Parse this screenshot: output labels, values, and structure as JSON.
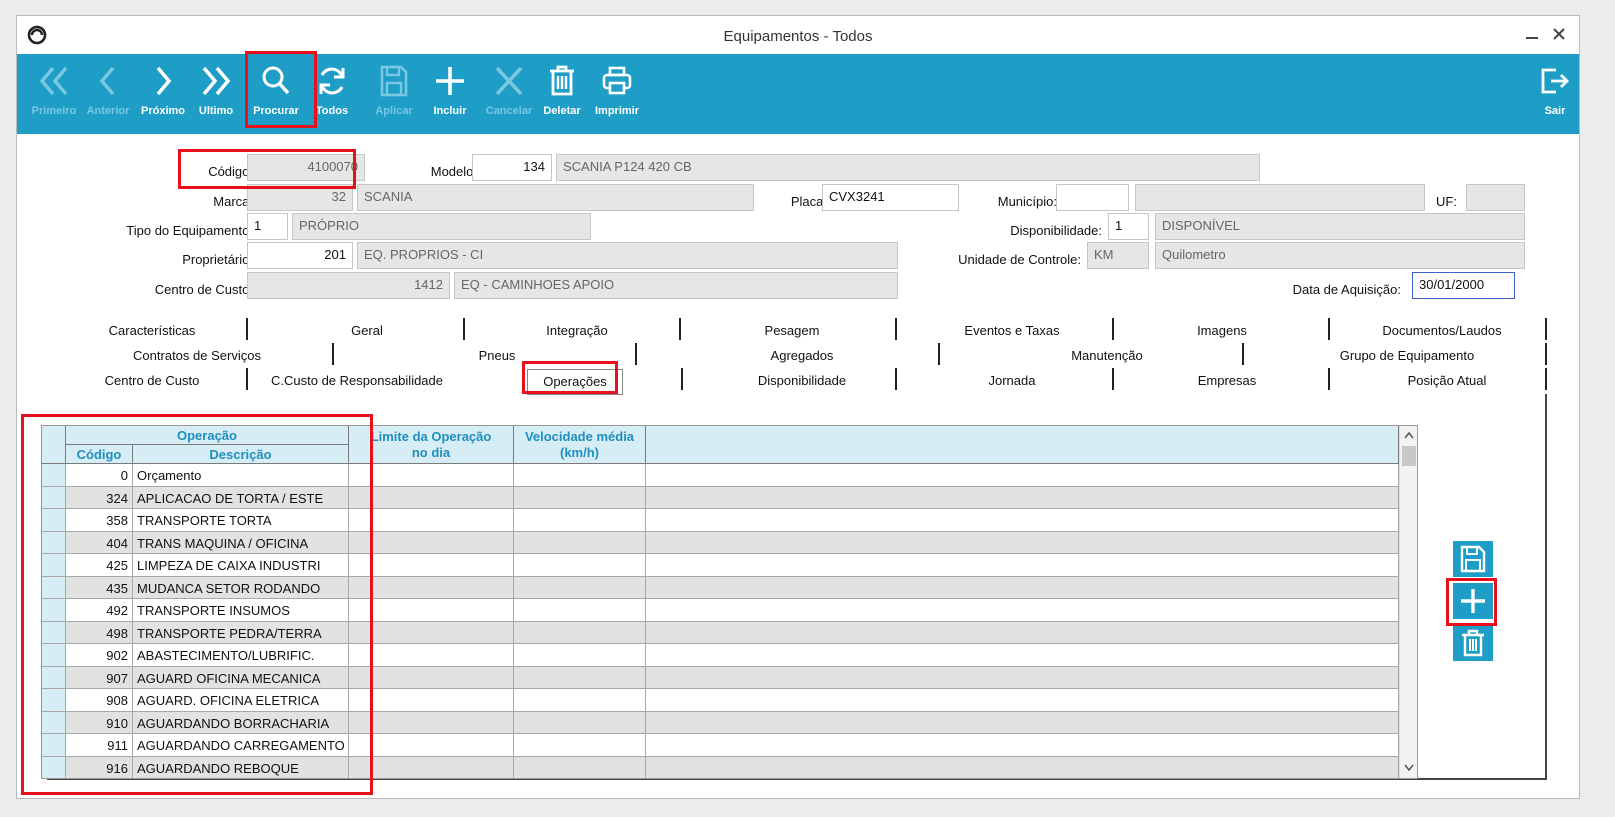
{
  "window": {
    "title": "Equipamentos - Todos"
  },
  "toolbar": {
    "buttons": [
      {
        "label": "Primeiro",
        "icon": "double-chevron-left-icon",
        "enabled": false
      },
      {
        "label": "Anterior",
        "icon": "chevron-left-icon",
        "enabled": false
      },
      {
        "label": "Próximo",
        "icon": "chevron-right-icon",
        "enabled": true
      },
      {
        "label": "Ultimo",
        "icon": "double-chevron-right-icon",
        "enabled": true
      },
      {
        "label": "Procurar",
        "icon": "search-icon",
        "enabled": true
      },
      {
        "label": "Todos",
        "icon": "refresh-icon",
        "enabled": true
      },
      {
        "label": "Aplicar",
        "icon": "save-icon",
        "enabled": false
      },
      {
        "label": "Incluir",
        "icon": "plus-icon",
        "enabled": true
      },
      {
        "label": "Cancelar",
        "icon": "close-icon",
        "enabled": false
      },
      {
        "label": "Deletar",
        "icon": "trash-icon",
        "enabled": true
      },
      {
        "label": "Imprimir",
        "icon": "printer-icon",
        "enabled": true
      }
    ],
    "exit": {
      "label": "Sair",
      "icon": "logout-icon"
    }
  },
  "form": {
    "codigo": {
      "label": "Código:",
      "value": "4100070"
    },
    "modelo": {
      "label": "Modelo:",
      "code": "134",
      "desc": "SCANIA P124 420 CB"
    },
    "marca": {
      "label": "Marca:",
      "code": "32",
      "desc": "SCANIA"
    },
    "placa": {
      "label": "Placa:",
      "value": "CVX3241"
    },
    "municipio": {
      "label": "Município:",
      "code": "",
      "desc": ""
    },
    "uf": {
      "label": "UF:",
      "value": ""
    },
    "tipo": {
      "label": "Tipo do Equipamento:",
      "code": "1",
      "desc": "PRÓPRIO"
    },
    "disponibilidade": {
      "label": "Disponibilidade:",
      "code": "1",
      "desc": "DISPONÍVEL"
    },
    "proprietario": {
      "label": "Proprietário:",
      "code": "201",
      "desc": "EQ. PROPRIOS - CI"
    },
    "unidade": {
      "label": "Unidade de Controle:",
      "code": "KM",
      "desc": "Quilometro"
    },
    "centro": {
      "label": "Centro de Custo:",
      "code": "1412",
      "desc": "EQ - CAMINHOES APOIO"
    },
    "aquisicao": {
      "label": "Data de Aquisição:",
      "value": "30/01/2000"
    }
  },
  "tabs": {
    "row1": [
      "Características",
      "Geral",
      "Integração",
      "Pesagem",
      "Eventos e Taxas",
      "Imagens",
      "Documentos/Laudos"
    ],
    "row2": [
      "Contratos de Serviços",
      "Pneus",
      "Agregados",
      "Manutenção",
      "Grupo de Equipamento"
    ],
    "row3": [
      "Centro de Custo",
      "C.Custo de Responsabilidade",
      "Operações",
      "Disponibilidade",
      "Jornada",
      "Empresas",
      "Posição Atual"
    ],
    "active": "Operações"
  },
  "grid": {
    "group_header": "Operação",
    "headers": {
      "codigo": "Código",
      "descricao": "Descrição",
      "limite": "Limite da Operação no dia",
      "velocidade": "Velocidade média (km/h)"
    },
    "rows": [
      {
        "codigo": "0",
        "descricao": "Orçamento"
      },
      {
        "codigo": "324",
        "descricao": "APLICACAO DE TORTA / ESTE"
      },
      {
        "codigo": "358",
        "descricao": "TRANSPORTE TORTA"
      },
      {
        "codigo": "404",
        "descricao": "TRANS MAQUINA / OFICINA"
      },
      {
        "codigo": "425",
        "descricao": "LIMPEZA DE CAIXA INDUSTRI"
      },
      {
        "codigo": "435",
        "descricao": "MUDANCA SETOR RODANDO"
      },
      {
        "codigo": "492",
        "descricao": "TRANSPORTE INSUMOS"
      },
      {
        "codigo": "498",
        "descricao": "TRANSPORTE PEDRA/TERRA"
      },
      {
        "codigo": "902",
        "descricao": "ABASTECIMENTO/LUBRIFIC."
      },
      {
        "codigo": "907",
        "descricao": "AGUARD OFICINA MECANICA"
      },
      {
        "codigo": "908",
        "descricao": "AGUARD. OFICINA ELETRICA"
      },
      {
        "codigo": "910",
        "descricao": "AGUARDANDO BORRACHARIA"
      },
      {
        "codigo": "911",
        "descricao": "AGUARDANDO CARREGAMENTO"
      },
      {
        "codigo": "916",
        "descricao": "AGUARDANDO REBOQUE"
      }
    ]
  },
  "side_actions": [
    {
      "icon": "save-icon"
    },
    {
      "icon": "plus-icon"
    },
    {
      "icon": "trash-icon"
    }
  ],
  "colors": {
    "accent": "#1e9ec6",
    "highlight": "#e8111b",
    "header_bg": "#d6edf5"
  }
}
